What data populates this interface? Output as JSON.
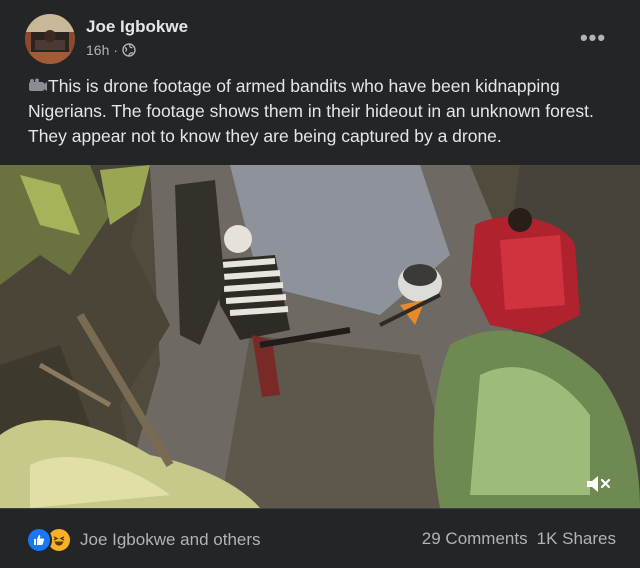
{
  "post": {
    "author": "Joe Igbokwe",
    "time": "16h",
    "separator": "·",
    "privacy_icon": "globe-icon",
    "menu_icon": "more-horizontal-icon",
    "body": "This is drone footage of armed bandits who have been kidnapping Nigerians. The footage shows them in their hideout in an unknown forest. They appear not to know they are being captured by a drone.",
    "body_icon": "tag-icon"
  },
  "video": {
    "volume_icon": "volume-muted-icon"
  },
  "footer": {
    "reaction_icons": [
      "like-reaction-icon",
      "haha-reaction-icon"
    ],
    "reactors": "Joe Igbokwe and others",
    "comments": "29 Comments",
    "shares": "1K Shares"
  },
  "colors": {
    "background": "#242526",
    "text_primary": "#e4e6eb",
    "text_secondary": "#b0b3b8",
    "like_blue": "#1877f2",
    "haha_yellow": "#f7b125"
  }
}
